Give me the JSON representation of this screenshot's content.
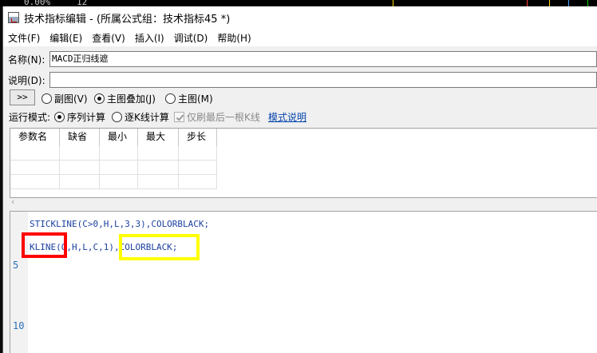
{
  "background": {
    "pct_text": "0.00%",
    "num_text": "12"
  },
  "window": {
    "title": "技术指标编辑 - (所属公式组：技术指标45 *)"
  },
  "menu": [
    {
      "label": "文件(F)"
    },
    {
      "label": "编辑(E)"
    },
    {
      "label": "查看(V)"
    },
    {
      "label": "插入(I)"
    },
    {
      "label": "调试(D)"
    },
    {
      "label": "帮助(H)"
    }
  ],
  "form": {
    "name_label": "名称(N):",
    "name_value": "MACD正归线遮",
    "desc_label": "说明(D):",
    "desc_value": "",
    "expand_label": ">>",
    "chart_options": [
      {
        "label": "副图(V)",
        "selected": false
      },
      {
        "label": "主图叠加(J)",
        "selected": true
      },
      {
        "label": "主图(M)",
        "selected": false
      }
    ],
    "run_mode_label": "运行模式:",
    "run_modes": [
      {
        "label": "序列计算",
        "selected": true
      },
      {
        "label": "逐K线计算",
        "selected": false
      }
    ],
    "only_last_label": "仅刷最后一根K线",
    "mode_help_link": "模式说明"
  },
  "params_table": {
    "headers": [
      "参数名",
      "缺省",
      "最小",
      "最大",
      "步长"
    ]
  },
  "editor": {
    "line_numbers": [
      "5",
      "10"
    ],
    "lines": [
      "STICKLINE(C>0,H,L,3,3),COLORBLACK;",
      "KLINE(O,H,L,C,1),COLORBLACK;"
    ]
  },
  "colors": {
    "highlight_red": "#ff0000",
    "highlight_yellow": "#ffff00",
    "code_text": "#1a3fa0",
    "link": "#0645ad"
  }
}
